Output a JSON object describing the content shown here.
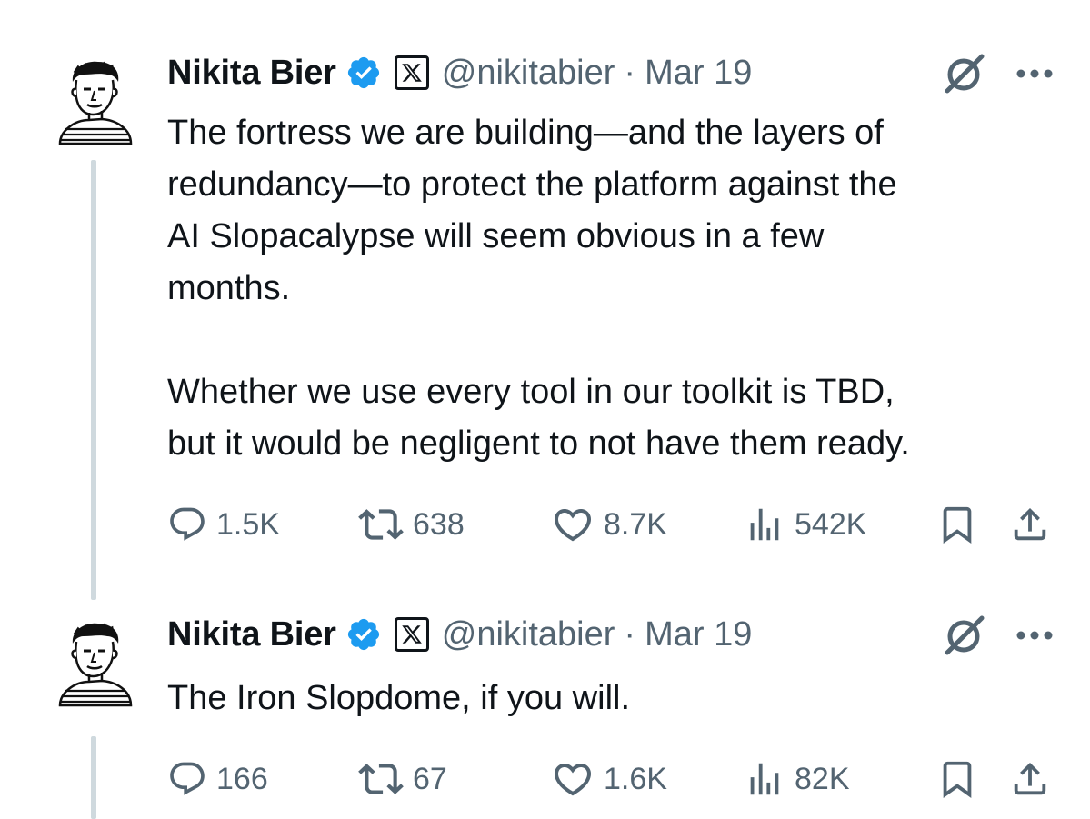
{
  "tweets": [
    {
      "author": {
        "name": "Nikita Bier",
        "handle": "@nikitabier",
        "separator": "·",
        "date": "Mar 19",
        "avatar_icon": "sketched-portrait-avatar",
        "verified_icon": "verified-badge-icon",
        "affiliate_icon": "x-logo-icon",
        "verified_color": "#1d9bf0"
      },
      "text": "The fortress we are building—and the layers of\nredundancy—to protect the platform against the\nAI Slopacalypse will seem obvious in a few\nmonths.\n\nWhether we use every tool in our toolkit is TBD,\nbut it would be negligent to not have them ready.",
      "stats": {
        "replies": "1.5K",
        "reposts": "638",
        "likes": "8.7K",
        "views": "542K"
      }
    },
    {
      "author": {
        "name": "Nikita Bier",
        "handle": "@nikitabier",
        "separator": "·",
        "date": "Mar 19",
        "avatar_icon": "sketched-portrait-avatar",
        "verified_icon": "verified-badge-icon",
        "affiliate_icon": "x-logo-icon",
        "verified_color": "#1d9bf0"
      },
      "text": "The Iron Slopdome, if you will.",
      "stats": {
        "replies": "166",
        "reposts": "67",
        "likes": "1.6K",
        "views": "82K"
      }
    }
  ],
  "icons": {
    "grok": "grok-icon",
    "more": "more-options-icon",
    "reply": "reply-icon",
    "repost": "repost-icon",
    "like": "like-icon",
    "views": "views-icon",
    "bookmark": "bookmark-icon",
    "share": "share-icon"
  },
  "colors": {
    "text": "#0f1419",
    "secondary": "#536471",
    "thread_line": "#cfd9de",
    "verified": "#1d9bf0"
  }
}
